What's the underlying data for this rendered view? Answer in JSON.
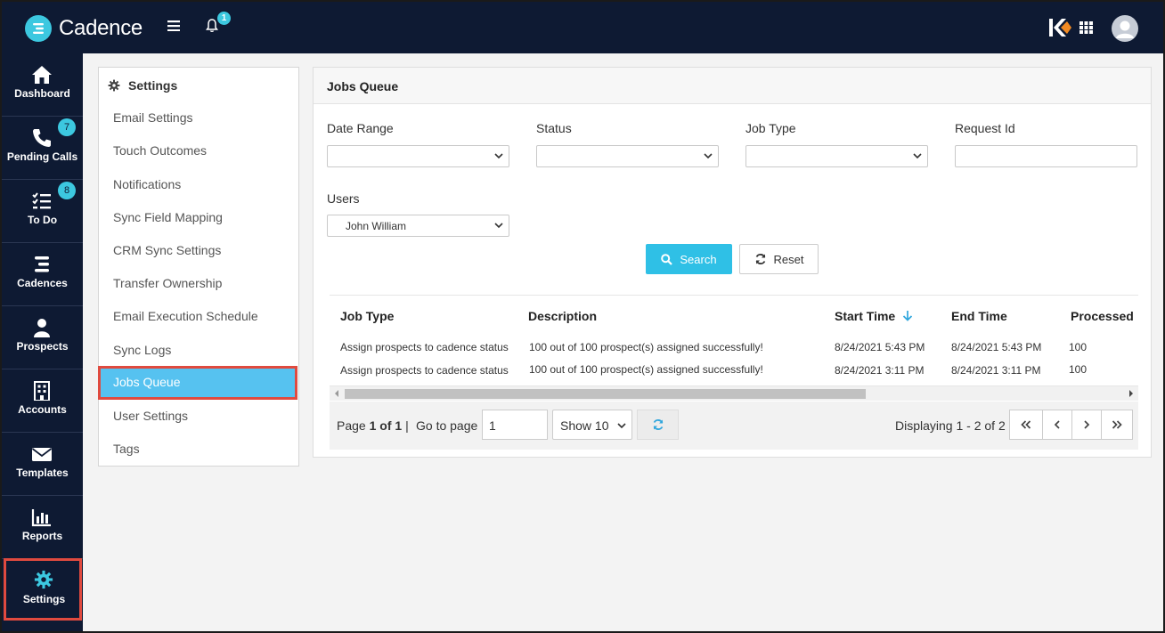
{
  "app": {
    "name": "Cadence",
    "notification_count": "1"
  },
  "nav": {
    "items": [
      {
        "label": "Dashboard",
        "icon": "home-icon"
      },
      {
        "label": "Pending Calls",
        "icon": "phone-icon",
        "badge": "7"
      },
      {
        "label": "To Do",
        "icon": "checklist-icon",
        "badge": "8"
      },
      {
        "label": "Cadences",
        "icon": "cadence-icon"
      },
      {
        "label": "Prospects",
        "icon": "person-icon"
      },
      {
        "label": "Accounts",
        "icon": "building-icon"
      },
      {
        "label": "Templates",
        "icon": "envelope-icon"
      },
      {
        "label": "Reports",
        "icon": "bar-chart-icon"
      },
      {
        "label": "Settings",
        "icon": "gear-icon"
      }
    ]
  },
  "settings": {
    "title": "Settings",
    "items": [
      "Email Settings",
      "Touch Outcomes",
      "Notifications",
      "Sync Field Mapping",
      "CRM Sync Settings",
      "Transfer Ownership",
      "Email Execution Schedule",
      "Sync Logs",
      "Jobs Queue",
      "User Settings",
      "Tags"
    ],
    "active": "Jobs Queue"
  },
  "jobs": {
    "title": "Jobs Queue",
    "filters": {
      "date_range_label": "Date Range",
      "status_label": "Status",
      "job_type_label": "Job Type",
      "request_id_label": "Request Id",
      "users_label": "Users",
      "users_value": "John William"
    },
    "search_label": "Search",
    "reset_label": "Reset",
    "columns": [
      "Job Type",
      "Description",
      "Start Time",
      "End Time",
      "Processed"
    ],
    "rows": [
      [
        "Assign prospects to cadence status",
        "100 out of 100 prospect(s) assigned successfully!",
        "8/24/2021 5:43 PM",
        "8/24/2021 5:43 PM",
        "100"
      ],
      [
        "Assign prospects to cadence status",
        "100 out of 100 prospect(s) assigned successfully!",
        "8/24/2021 3:11 PM",
        "8/24/2021 3:11 PM",
        "100"
      ]
    ],
    "pager": {
      "page_word": "Page",
      "page_of": "1 of 1",
      "separator": "|",
      "goto_label": "Go to page",
      "goto_value": "1",
      "show_value": "Show 10",
      "displaying": "Displaying 1 - 2 of 2"
    }
  },
  "colors": {
    "navy": "#0e1a33",
    "accent": "#2fc0e6",
    "highlight": "#e04a3f"
  }
}
